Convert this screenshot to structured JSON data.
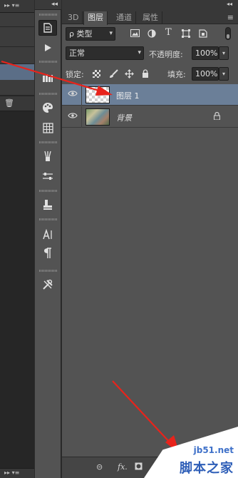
{
  "left_panel": {
    "top_controls": "▸▸ ▾≡",
    "footer_controls": "▸▸ ▾≡"
  },
  "tool_strip": {
    "collapse_arrows": "◂◂"
  },
  "layers_panel": {
    "collapse_arrows": "◂◂",
    "tabs": [
      {
        "label": "3D",
        "active": false
      },
      {
        "label": "图层",
        "active": true
      },
      {
        "label": "通道",
        "active": false
      },
      {
        "label": "属性",
        "active": false
      }
    ],
    "filter": {
      "value": "ρ 类型",
      "arrow": "▾"
    },
    "blend_mode": {
      "value": "正常",
      "arrow": "▾"
    },
    "opacity": {
      "label": "不透明度:",
      "value": "100%"
    },
    "lock": {
      "label": "锁定:"
    },
    "fill": {
      "label": "填充:",
      "value": "100%"
    },
    "layers": [
      {
        "name": "图层 1",
        "selected": true,
        "visible": true,
        "locked": false,
        "thumbnail": "transparent"
      },
      {
        "name": "背景",
        "selected": false,
        "visible": true,
        "locked": true,
        "thumbnail": "photo"
      }
    ],
    "footer": {
      "link": "⊝",
      "fx": "fx."
    }
  },
  "watermark": {
    "url": "jb51.net",
    "brand": "脚本之家"
  },
  "colors": {
    "panel_bg": "#535353",
    "tab_bar": "#383838",
    "selected_layer": "#6b7f98",
    "annotation_arrow": "#e8231b"
  }
}
